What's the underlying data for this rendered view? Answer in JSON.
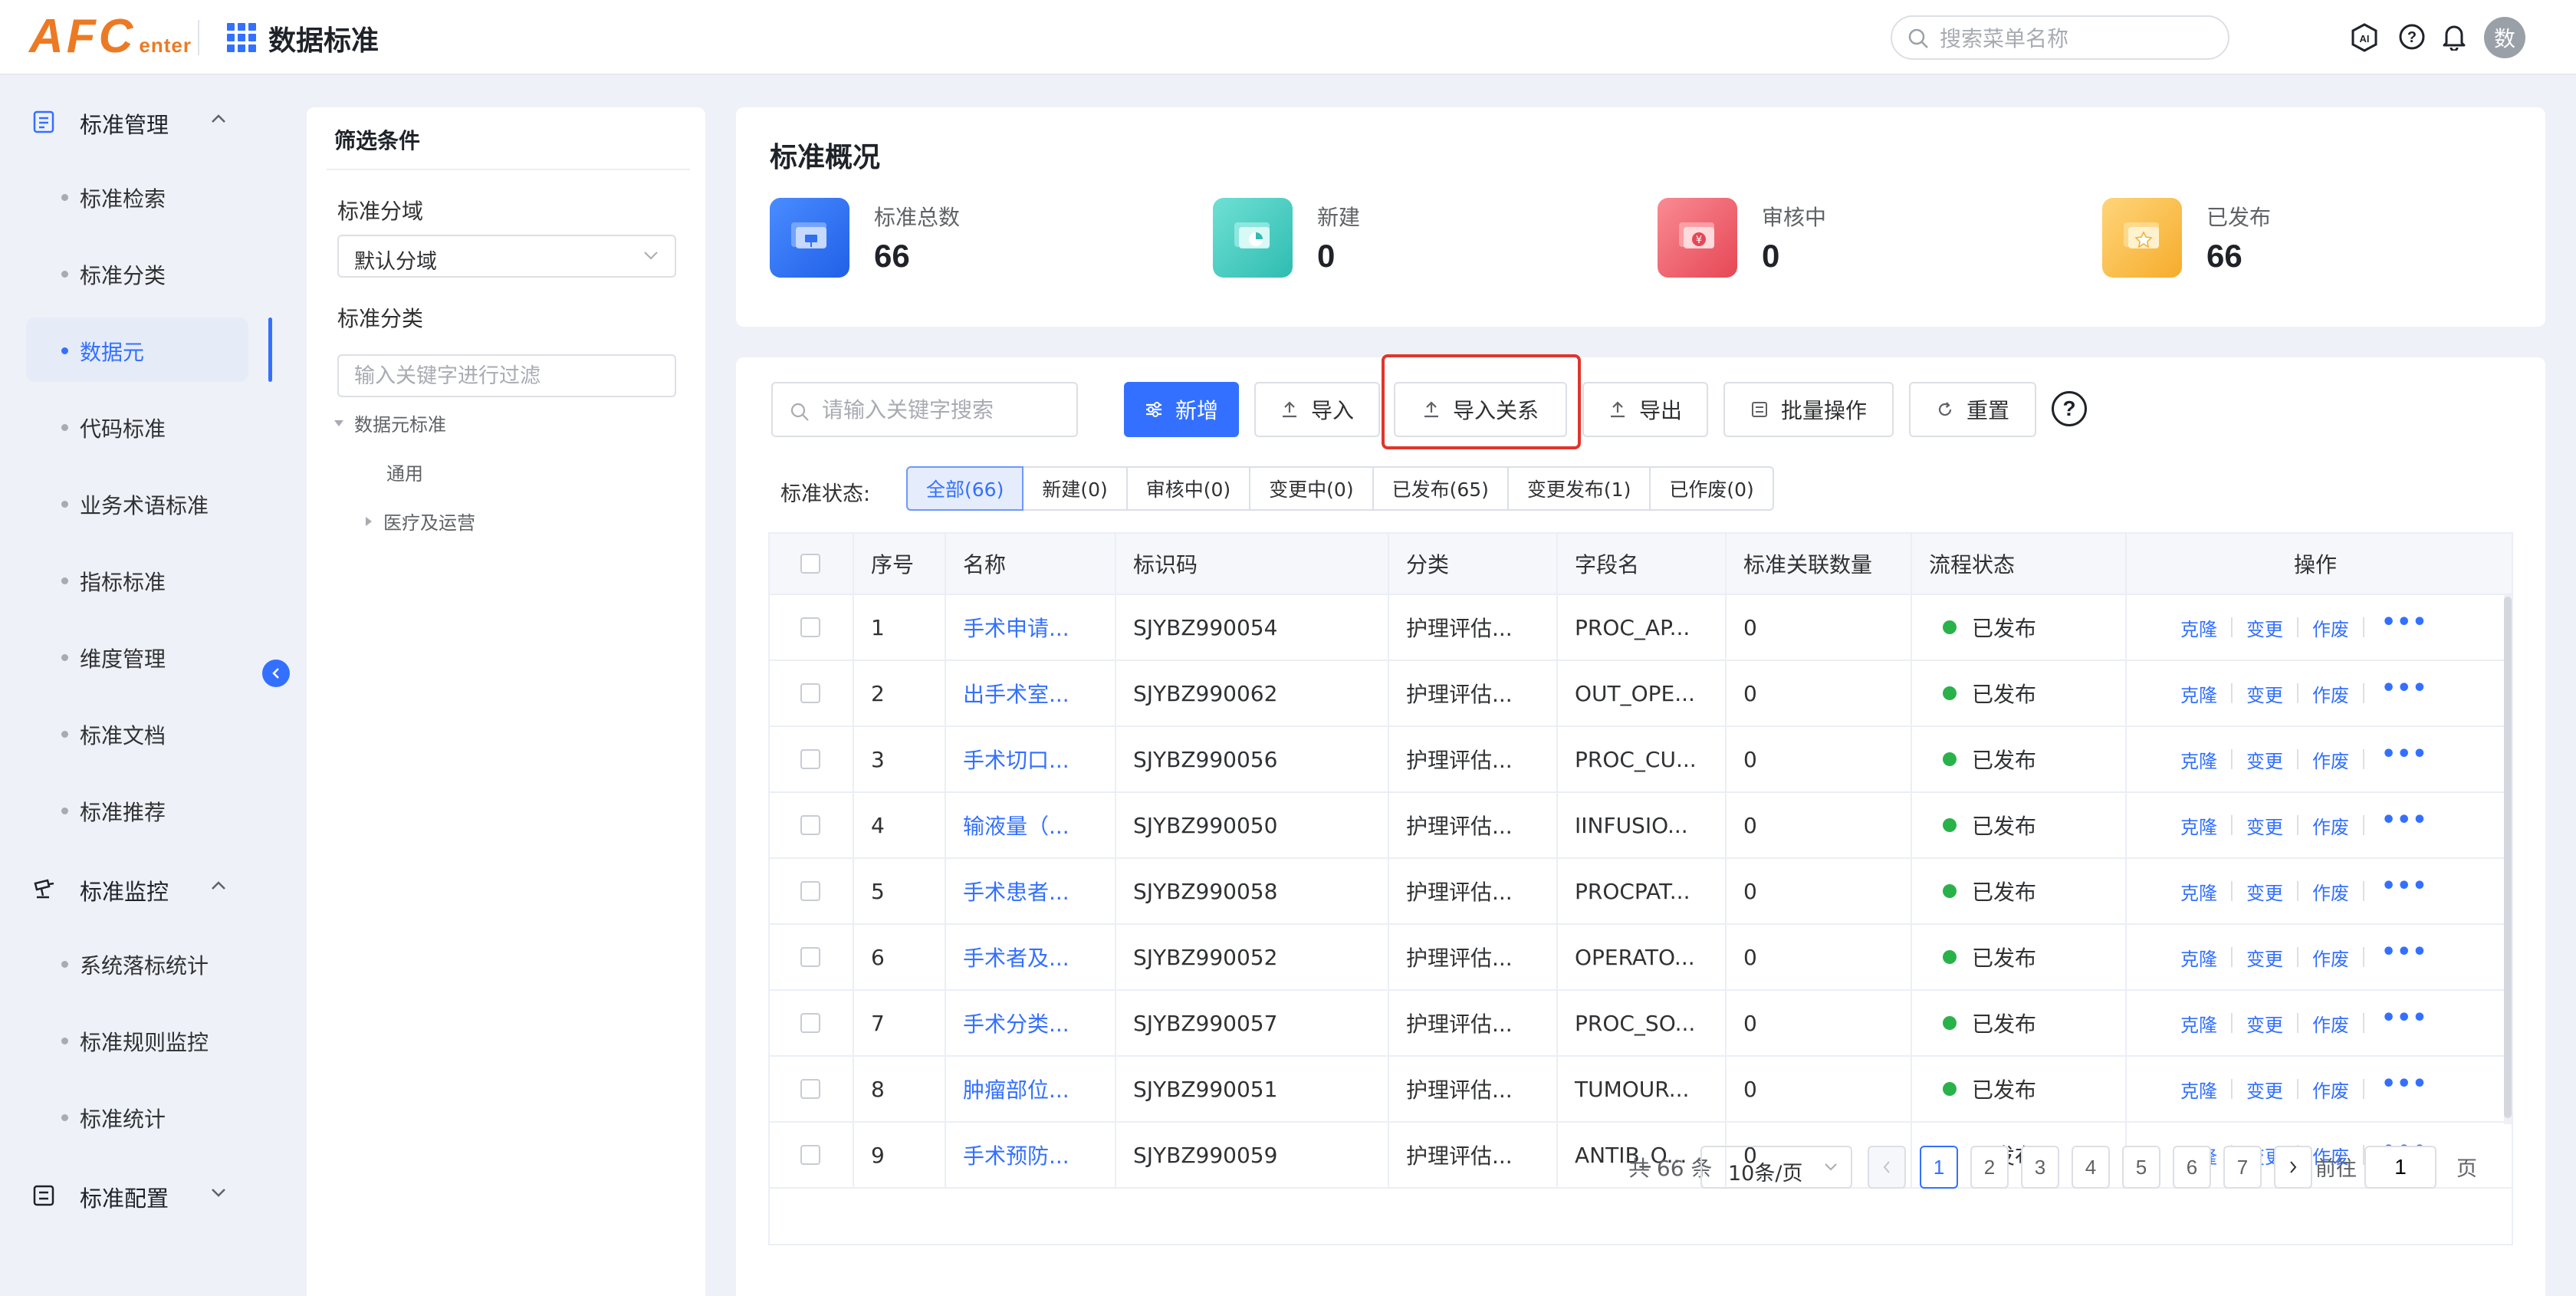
{
  "header": {
    "logo_big": "AFC",
    "logo_small": "enter",
    "app_title": "数据标准",
    "search_placeholder": "搜索菜单名称",
    "avatar_text": "数"
  },
  "sidebar": {
    "groups": [
      {
        "label": "标准管理",
        "icon": "document-icon",
        "expanded": true
      },
      {
        "label": "标准监控",
        "icon": "monitor-icon",
        "expanded": true
      },
      {
        "label": "标准配置",
        "icon": "config-icon",
        "expanded": false
      }
    ],
    "items": [
      {
        "label": "标准检索"
      },
      {
        "label": "标准分类"
      },
      {
        "label": "数据元",
        "active": true
      },
      {
        "label": "代码标准"
      },
      {
        "label": "业务术语标准"
      },
      {
        "label": "指标标准"
      },
      {
        "label": "维度管理"
      },
      {
        "label": "标准文档"
      },
      {
        "label": "标准推荐"
      },
      {
        "label": "系统落标统计"
      },
      {
        "label": "标准规则监控"
      },
      {
        "label": "标准统计"
      }
    ]
  },
  "filter": {
    "title": "筛选条件",
    "domain_label": "标准分域",
    "domain_value": "默认分域",
    "category_label": "标准分类",
    "keyword_placeholder": "输入关键字进行过滤",
    "tree": {
      "root": "数据元标准",
      "child1": "通用",
      "child2": "医疗及运营"
    }
  },
  "overview": {
    "title": "标准概况",
    "stats": [
      {
        "label": "标准总数",
        "value": "66",
        "color": "#2f6ff0"
      },
      {
        "label": "新建",
        "value": "0",
        "color": "#3ecbc0"
      },
      {
        "label": "审核中",
        "value": "0",
        "color": "#ee5f6a"
      },
      {
        "label": "已发布",
        "value": "66",
        "color": "#f8be4a"
      }
    ]
  },
  "toolbar": {
    "search_placeholder": "请输入关键字搜索",
    "add_label": "新增",
    "import_label": "导入",
    "import_relation_label": "导入关系",
    "export_label": "导出",
    "batch_label": "批量操作",
    "reset_label": "重置",
    "help_label": "?"
  },
  "status": {
    "label": "标准状态:",
    "tabs": [
      "全部(66)",
      "新建(0)",
      "审核中(0)",
      "变更中(0)",
      "已发布(65)",
      "变更发布(1)",
      "已作废(0)"
    ]
  },
  "table": {
    "headers": [
      "序号",
      "名称",
      "标识码",
      "分类",
      "字段名",
      "标准关联数量",
      "流程状态",
      "操作"
    ],
    "rows": [
      {
        "no": "1",
        "name": "手术申请...",
        "code": "SJYBZ990054",
        "category": "护理评估...",
        "field": "PROC_AP...",
        "count": "0",
        "status": "已发布"
      },
      {
        "no": "2",
        "name": "出手术室...",
        "code": "SJYBZ990062",
        "category": "护理评估...",
        "field": "OUT_OPE...",
        "count": "0",
        "status": "已发布"
      },
      {
        "no": "3",
        "name": "手术切口...",
        "code": "SJYBZ990056",
        "category": "护理评估...",
        "field": "PROC_CU...",
        "count": "0",
        "status": "已发布"
      },
      {
        "no": "4",
        "name": "输液量（...",
        "code": "SJYBZ990050",
        "category": "护理评估...",
        "field": "IINFUSIO...",
        "count": "0",
        "status": "已发布"
      },
      {
        "no": "5",
        "name": "手术患者...",
        "code": "SJYBZ990058",
        "category": "护理评估...",
        "field": "PROCPAT...",
        "count": "0",
        "status": "已发布"
      },
      {
        "no": "6",
        "name": "手术者及...",
        "code": "SJYBZ990052",
        "category": "护理评估...",
        "field": "OPERATO...",
        "count": "0",
        "status": "已发布"
      },
      {
        "no": "7",
        "name": "手术分类...",
        "code": "SJYBZ990057",
        "category": "护理评估...",
        "field": "PROC_SO...",
        "count": "0",
        "status": "已发布"
      },
      {
        "no": "8",
        "name": "肿瘤部位...",
        "code": "SJYBZ990051",
        "category": "护理评估...",
        "field": "TUMOUR...",
        "count": "0",
        "status": "已发布"
      },
      {
        "no": "9",
        "name": "手术预防...",
        "code": "SJYBZ990059",
        "category": "护理评估...",
        "field": "ANTIB_O...",
        "count": "0",
        "status": "已发布"
      }
    ],
    "ops": [
      "克隆",
      "变更",
      "作废"
    ],
    "more": "•••"
  },
  "pagination": {
    "total": "共 66 条",
    "page_size": "10条/页",
    "pages": [
      "1",
      "2",
      "3",
      "4",
      "5",
      "6",
      "7"
    ],
    "current": "1",
    "goto_label": "前往",
    "goto_value": "1",
    "page_unit": "页"
  },
  "colors": {
    "primary": "#3370ff",
    "published": "#2ab24a",
    "highlight": "#e0352b"
  }
}
